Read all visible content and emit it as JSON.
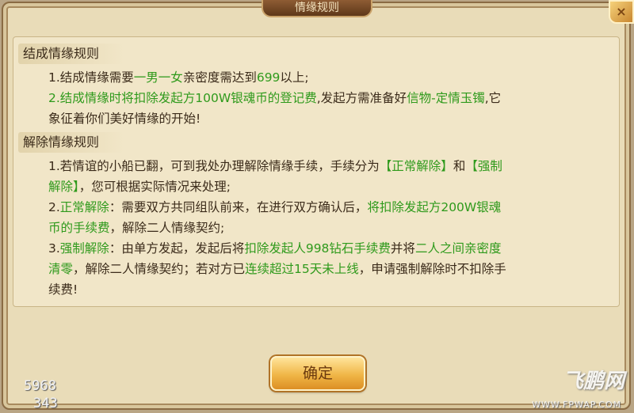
{
  "dialog": {
    "title": "情缘规则",
    "close_icon": "×",
    "confirm_label": "确定"
  },
  "sections": [
    {
      "header": "结成情缘规则",
      "lines": [
        [
          {
            "t": "1.结成情缘需要"
          },
          {
            "t": "一男一女",
            "g": true
          },
          {
            "t": "亲密度需达到"
          },
          {
            "t": "699",
            "g": true
          },
          {
            "t": "以上;"
          }
        ],
        [
          {
            "t": "2.结成情缘时将扣除发起方100W银魂币的登记费",
            "g": true
          },
          {
            "t": ",发起方需准备好"
          },
          {
            "t": "信物-定情玉镯",
            "g": true
          },
          {
            "t": ",它"
          }
        ],
        [
          {
            "t": "象征着你们美好情缘的开始!"
          }
        ]
      ]
    },
    {
      "header": "解除情缘规则",
      "lines": [
        [
          {
            "t": "1.若情谊的小船已翻，可到我处办理解除情缘手续，手续分为"
          },
          {
            "t": "【正常解除】",
            "g": true
          },
          {
            "t": "和"
          },
          {
            "t": "【强制",
            "g": true
          }
        ],
        [
          {
            "t": "解除】",
            "g": true
          },
          {
            "t": "，您可根据实际情况来处理;"
          }
        ],
        [
          {
            "t": "2."
          },
          {
            "t": "正常解除",
            "g": true
          },
          {
            "t": "：需要双方共同组队前来，在进行双方确认后，"
          },
          {
            "t": "将扣除发起方200W银魂",
            "g": true
          }
        ],
        [
          {
            "t": "币的手续费",
            "g": true
          },
          {
            "t": "，解除二人情缘契约;"
          }
        ],
        [
          {
            "t": "3."
          },
          {
            "t": "强制解除",
            "g": true
          },
          {
            "t": "：由单方发起，发起后将"
          },
          {
            "t": "扣除发起人998钻石手续费",
            "g": true
          },
          {
            "t": "并将"
          },
          {
            "t": "二人之间亲密度",
            "g": true
          }
        ],
        [
          {
            "t": "清零",
            "g": true
          },
          {
            "t": "，解除二人情缘契约；若对方已"
          },
          {
            "t": "连续超过15天未上线",
            "g": true
          },
          {
            "t": "，申请强制解除时不扣除手"
          }
        ],
        [
          {
            "t": "续费!"
          }
        ]
      ]
    }
  ],
  "overlay": {
    "coord_top": "5968",
    "coord_bottom": "343",
    "watermark": "飞鹏网",
    "watermark_sub": "WWW.FPWAP.COM"
  },
  "colors": {
    "highlight_green": "#2f9a1c",
    "body_text": "#3b2b1a",
    "panel_bg": "#f1e6c8"
  }
}
